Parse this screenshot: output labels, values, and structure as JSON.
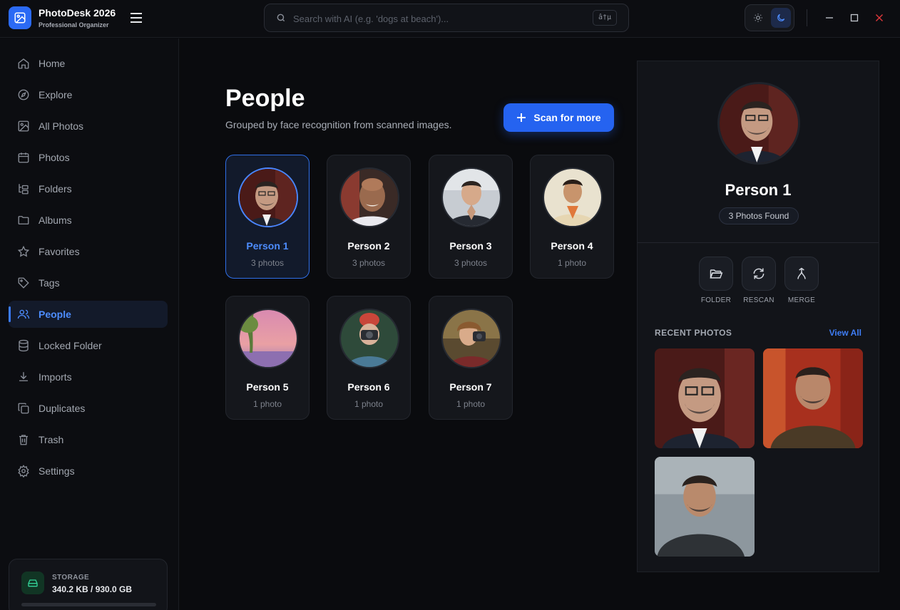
{
  "app": {
    "title": "PhotoDesk 2026",
    "subtitle": "Professional Organizer",
    "accent": "#2563f0"
  },
  "search": {
    "placeholder": "Search with AI (e.g. 'dogs at beach')...",
    "value": "",
    "shortcut": "â†µ"
  },
  "sidebar": {
    "items": [
      {
        "label": "Home",
        "icon": "home-icon",
        "active": false
      },
      {
        "label": "Explore",
        "icon": "compass-icon",
        "active": false
      },
      {
        "label": "All Photos",
        "icon": "image-icon",
        "active": false
      },
      {
        "label": "Photos",
        "icon": "calendar-icon",
        "active": false
      },
      {
        "label": "Folders",
        "icon": "folder-tree-icon",
        "active": false
      },
      {
        "label": "Albums",
        "icon": "folder-icon",
        "active": false
      },
      {
        "label": "Favorites",
        "icon": "star-icon",
        "active": false
      },
      {
        "label": "Tags",
        "icon": "tag-icon",
        "active": false
      },
      {
        "label": "People",
        "icon": "users-icon",
        "active": true
      },
      {
        "label": "Locked Folder",
        "icon": "database-icon",
        "active": false
      },
      {
        "label": "Imports",
        "icon": "download-icon",
        "active": false
      },
      {
        "label": "Duplicates",
        "icon": "copy-icon",
        "active": false
      },
      {
        "label": "Trash",
        "icon": "trash-icon",
        "active": false
      },
      {
        "label": "Settings",
        "icon": "gear-icon",
        "active": false
      }
    ],
    "storage": {
      "title": "STORAGE",
      "value": "340.2 KB / 930.0 GB",
      "used_fraction": 0.0
    }
  },
  "main": {
    "title": "People",
    "subtitle": "Grouped by face recognition from scanned images.",
    "scan_label": "Scan for more",
    "people": [
      {
        "name": "Person 1",
        "count": "3 photos",
        "selected": true
      },
      {
        "name": "Person 2",
        "count": "3 photos",
        "selected": false
      },
      {
        "name": "Person 3",
        "count": "3 photos",
        "selected": false
      },
      {
        "name": "Person 4",
        "count": "1 photo",
        "selected": false
      },
      {
        "name": "Person 5",
        "count": "1 photo",
        "selected": false
      },
      {
        "name": "Person 6",
        "count": "1 photo",
        "selected": false
      },
      {
        "name": "Person 7",
        "count": "1 photo",
        "selected": false
      }
    ]
  },
  "detail": {
    "name": "Person 1",
    "badge": "3 Photos Found",
    "actions": [
      {
        "label": "FOLDER",
        "icon": "folder-open-icon"
      },
      {
        "label": "RESCAN",
        "icon": "refresh-icon"
      },
      {
        "label": "MERGE",
        "icon": "merge-icon"
      }
    ],
    "recent_title": "RECENT PHOTOS",
    "view_all": "View All"
  }
}
